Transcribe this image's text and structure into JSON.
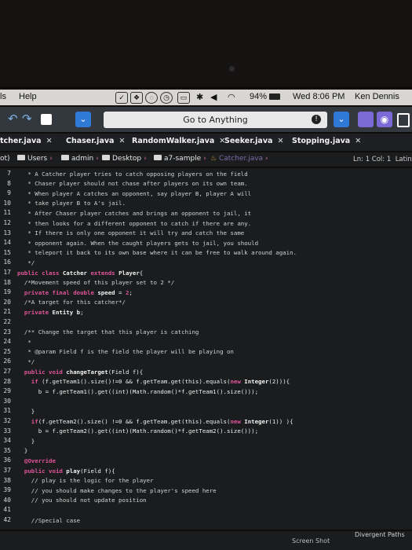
{
  "menubar": {
    "left_label": "ls",
    "help": "Help",
    "battery": "94%",
    "clock": "Wed 8:06 PM",
    "user": "Ken Dennis"
  },
  "toolbar": {
    "goto_label": "Go to Anything"
  },
  "tabs": [
    {
      "label": "tcher.java"
    },
    {
      "label": "Chaser.java"
    },
    {
      "label": "RandomWalker.java"
    },
    {
      "label": "Seeker.java"
    },
    {
      "label": "Stopping.java"
    }
  ],
  "breadcrumb": {
    "lead": "ot)",
    "items": [
      "Users",
      "admin",
      "Desktop",
      "a7-sample"
    ],
    "current": "Catcher.java"
  },
  "status": {
    "position": "Ln: 1 Col: 1",
    "lang": "Latin"
  },
  "editor": {
    "line_numbers": [
      "7",
      "8",
      "9",
      "10",
      "11",
      "12",
      "13",
      "14",
      "15",
      "16",
      "17",
      "18",
      "19",
      "20",
      "21",
      "22",
      "23",
      "24",
      "25",
      "26",
      "27",
      "28",
      "29",
      "30",
      "31",
      "32",
      "33",
      "34",
      "35",
      "36",
      "37",
      "38",
      "39",
      "40",
      "41",
      "42"
    ],
    "lines": [
      [
        {
          "t": "c",
          "v": "   * A Catcher player tries to catch opposing players on the field"
        }
      ],
      [
        {
          "t": "c",
          "v": "   * Chaser player should not chase after players on its own team."
        }
      ],
      [
        {
          "t": "c",
          "v": "   * When player A catches an opponent, say player B, player A will"
        }
      ],
      [
        {
          "t": "c",
          "v": "   * take player B to A's jail."
        }
      ],
      [
        {
          "t": "c",
          "v": "   * After Chaser player catches and brings an opponent to jail, it"
        }
      ],
      [
        {
          "t": "c",
          "v": "   * then looks for a different opponent to catch if there are any."
        }
      ],
      [
        {
          "t": "c",
          "v": "   * If there is only one opponent it will try and catch the same"
        }
      ],
      [
        {
          "t": "c",
          "v": "   * opponent again. When the caught players gets to jail, you should"
        }
      ],
      [
        {
          "t": "c",
          "v": "   * teleport it back to its own base where it can be free to walk around again."
        }
      ],
      [
        {
          "t": "c",
          "v": "   */"
        }
      ],
      [
        {
          "t": "k",
          "v": "public class "
        },
        {
          "t": "y",
          "v": "Catcher "
        },
        {
          "t": "k",
          "v": "extends "
        },
        {
          "t": "y",
          "v": "Player"
        },
        {
          "t": "p",
          "v": "{"
        }
      ],
      [
        {
          "t": "c",
          "v": "  /*Movement speed of this player set to 2 */"
        }
      ],
      [
        {
          "t": "k",
          "v": "  private final double "
        },
        {
          "t": "y",
          "v": "speed"
        },
        {
          "t": "p",
          "v": " = "
        },
        {
          "t": "k",
          "v": "2"
        },
        {
          "t": "p",
          "v": ";"
        }
      ],
      [
        {
          "t": "c",
          "v": "  /*A target for this catcher*/"
        }
      ],
      [
        {
          "t": "k",
          "v": "  private "
        },
        {
          "t": "y",
          "v": "Entity b"
        },
        {
          "t": "p",
          "v": ";"
        }
      ],
      [
        {
          "t": "p",
          "v": ""
        }
      ],
      [
        {
          "t": "c",
          "v": "  /** Change the target that this player is catching"
        }
      ],
      [
        {
          "t": "c",
          "v": "   *"
        }
      ],
      [
        {
          "t": "c",
          "v": "   * @param Field f is the field the player will be playing on"
        }
      ],
      [
        {
          "t": "c",
          "v": "   */"
        }
      ],
      [
        {
          "t": "k",
          "v": "  public void "
        },
        {
          "t": "y",
          "v": "changeTarget"
        },
        {
          "t": "p",
          "v": "(Field f){"
        }
      ],
      [
        {
          "t": "k",
          "v": "    if "
        },
        {
          "t": "p",
          "v": "(f.getTeam1().size()!=0 && f.getTeam.get(this).equals("
        },
        {
          "t": "k",
          "v": "new "
        },
        {
          "t": "y",
          "v": "Integer"
        },
        {
          "t": "p",
          "v": "(2))){"
        }
      ],
      [
        {
          "t": "p",
          "v": "      b = f.getTeam1().get((int)(Math.random()*f.getTeam1().size()));"
        }
      ],
      [
        {
          "t": "p",
          "v": ""
        }
      ],
      [
        {
          "t": "p",
          "v": "    }"
        }
      ],
      [
        {
          "t": "k",
          "v": "    if"
        },
        {
          "t": "p",
          "v": "(f.getTeam2().size() !=0 && f.getTeam.get(this).equals("
        },
        {
          "t": "k",
          "v": "new "
        },
        {
          "t": "y",
          "v": "Integer"
        },
        {
          "t": "p",
          "v": "(1)) ){"
        }
      ],
      [
        {
          "t": "p",
          "v": "      b = f.getTeam2().get((int)(Math.random()*f.getTeam2().size()));"
        }
      ],
      [
        {
          "t": "p",
          "v": "    }"
        }
      ],
      [
        {
          "t": "p",
          "v": "  }"
        }
      ],
      [
        {
          "t": "k",
          "v": "  @Override"
        }
      ],
      [
        {
          "t": "k",
          "v": "  public void "
        },
        {
          "t": "y",
          "v": "play"
        },
        {
          "t": "p",
          "v": "(Field f){"
        }
      ],
      [
        {
          "t": "c",
          "v": "    // play is the logic for the player"
        }
      ],
      [
        {
          "t": "c",
          "v": "    // you should make changes to the player's speed here"
        }
      ],
      [
        {
          "t": "c",
          "v": "    // you should not update position"
        }
      ],
      [
        {
          "t": "p",
          "v": ""
        }
      ],
      [
        {
          "t": "c",
          "v": "    //Special case"
        }
      ]
    ]
  },
  "watermark": {
    "center": "Screen Shot",
    "right": "Divergent Paths"
  }
}
